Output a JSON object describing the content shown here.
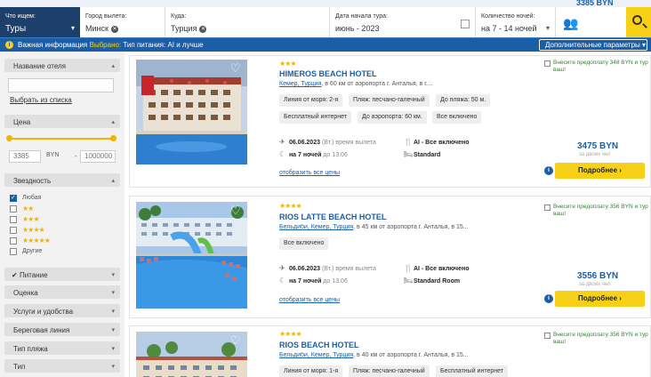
{
  "search": {
    "top_price": "3385 BYN",
    "what_label": "Что ищем:",
    "what_value": "Туры",
    "from_label": "Город вылета:",
    "from_value": "Минск",
    "to_label": "Куда:",
    "to_value": "Турция",
    "date_label": "Дата начала тура:",
    "date_value": "июнь - 2023",
    "nights_label": "Количество ночей:",
    "nights_value": "на 7 - 14 ночей"
  },
  "infobar": {
    "important": "Важная информация",
    "selected": "Выбрано:",
    "food": "Тип питания: AI и лучше",
    "more_params": "Дополнительные параметры"
  },
  "sidebar": {
    "hotel_name": "Название отеля",
    "hotel_input": "",
    "pick_from_list": "Выбрать из списка",
    "price": "Цена",
    "price_min": "3385",
    "currency": "BYN",
    "dash": "-",
    "price_max": "1000000",
    "stars": "Звездность",
    "star_options": [
      {
        "label": "Любая",
        "stars": "",
        "checked": true
      },
      {
        "label": "",
        "stars": "★★",
        "checked": false
      },
      {
        "label": "",
        "stars": "★★★",
        "checked": false
      },
      {
        "label": "",
        "stars": "★★★★",
        "checked": false
      },
      {
        "label": "",
        "stars": "★★★★★",
        "checked": false
      },
      {
        "label": "Другие",
        "stars": "",
        "checked": false
      }
    ],
    "sections": [
      "Питание",
      "Оценка",
      "Услуги и удобства",
      "Береговая линия",
      "Тип пляжа",
      "Тип"
    ]
  },
  "cards": [
    {
      "stars": "★★★",
      "name": "HIMEROS BEACH HOTEL",
      "location_link": "Кемер, Турция",
      "location_rest": ", в 60 км от аэропорта г. Анталья, в г....",
      "tags": [
        "Линия от моря: 2-я",
        "Пляж: песчано-галечный",
        "До пляжа: 50 м.",
        "Бесплатный интернет",
        "До аэропорта: 60 км.",
        "Все включено"
      ],
      "date": "06.06.2023",
      "date_note": "(Вт.) время вылета",
      "nights": "на 7 ночей",
      "nights_note": "до 13.06",
      "meal": "AI - Все включено",
      "room": "Standard",
      "all_prices": "отобразить все цены",
      "promo": "Внесите предоплату 348 BYN и тур ваш!",
      "price": "3475 BYN",
      "price_sub": "за двоих чел",
      "more": "Подробнее ›"
    },
    {
      "stars": "★★★★",
      "name": "RIOS LATTE BEACH HOTEL",
      "location_link": "Бельдиби, Кемер, Турция",
      "location_rest": ", в 45 км от аэропорта г. Анталья, в 15...",
      "tags": [
        "Все включено"
      ],
      "date": "06.06.2023",
      "date_note": "(Вт.) время вылета",
      "nights": "на 7 ночей",
      "nights_note": "до 13.06",
      "meal": "AI - Все включено",
      "room": "Standard Room",
      "all_prices": "отобразить все цены",
      "promo": "Внесите предоплату 356 BYN и тур ваш!",
      "price": "3556 BYN",
      "price_sub": "за двоих чел",
      "more": "Подробнее ›"
    },
    {
      "stars": "★★★★",
      "name": "RIOS BEACH HOTEL",
      "location_link": "Бельдиби, Кемер, Турция",
      "location_rest": ", в 40 км от аэропорта г. Анталья, в 15...",
      "tags": [
        "Линия от моря: 1-я",
        "Пляж: песчано-галечный",
        "Бесплатный интернет"
      ],
      "promo": "Внесите предоплату 356 BYN и тур ваш!"
    }
  ],
  "colors": {
    "brand": "#1b5ea8",
    "accent": "#f7d117",
    "star": "#f0b400",
    "promo": "#2a8a2a"
  }
}
